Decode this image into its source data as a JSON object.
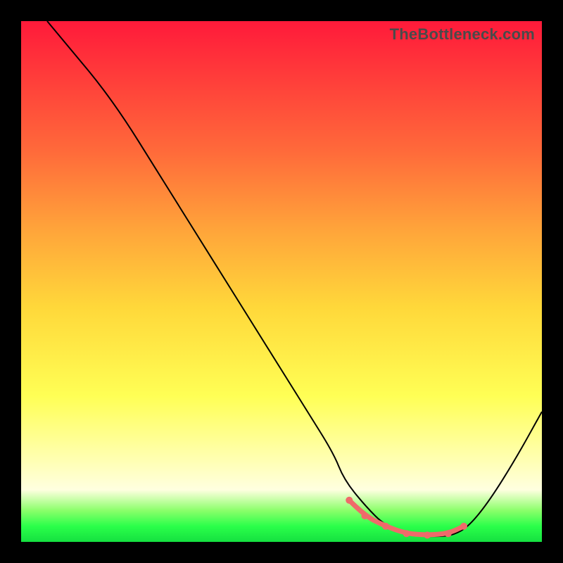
{
  "watermark": "TheBottleneck.com",
  "chart_data": {
    "type": "line",
    "title": "",
    "xlabel": "",
    "ylabel": "",
    "xlim": [
      0,
      100
    ],
    "ylim": [
      0,
      100
    ],
    "grid": false,
    "series": [
      {
        "name": "bottleneck-curve",
        "color": "#000000",
        "x": [
          5,
          10,
          15,
          20,
          25,
          30,
          35,
          40,
          45,
          50,
          55,
          60,
          62,
          66,
          70,
          75,
          80,
          83,
          86,
          90,
          95,
          100
        ],
        "y": [
          100,
          94,
          88,
          81,
          73,
          65,
          57,
          49,
          41,
          33,
          25,
          17,
          12,
          7,
          3,
          1.2,
          1.0,
          1.3,
          3,
          8,
          16,
          25
        ]
      }
    ],
    "annotations": [
      {
        "name": "optimal-range",
        "color": "#ef6a6a",
        "x": [
          63,
          66,
          70,
          74,
          78,
          82,
          85
        ],
        "y": [
          8,
          5,
          3,
          1.6,
          1.3,
          1.6,
          3
        ]
      }
    ]
  }
}
